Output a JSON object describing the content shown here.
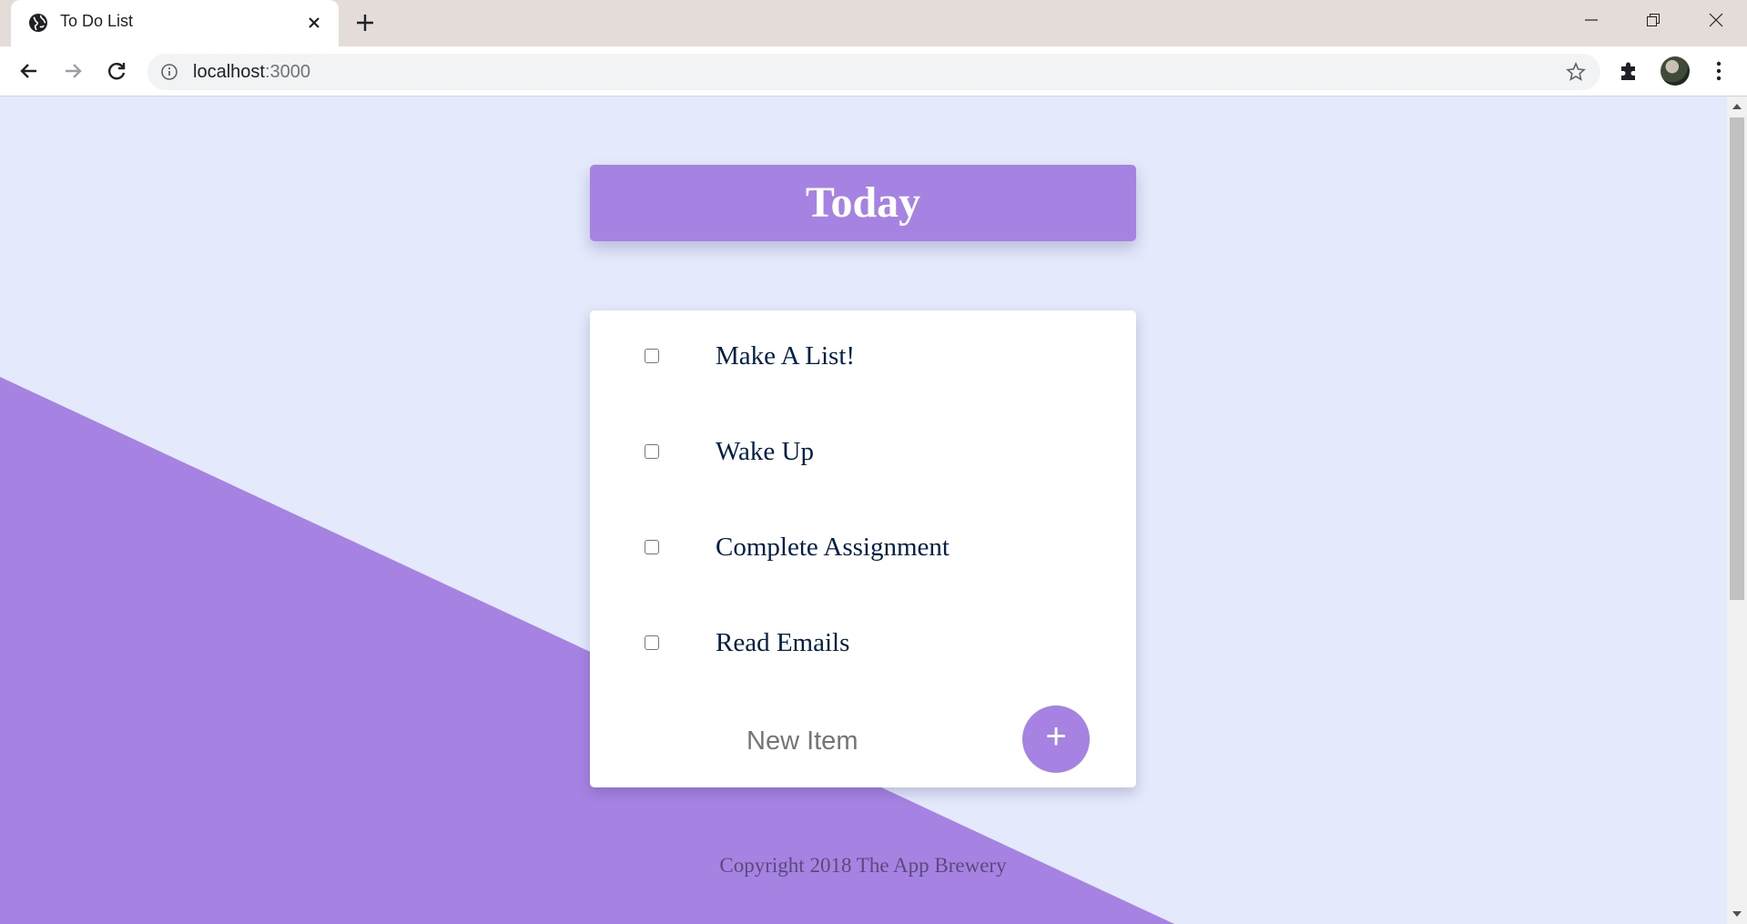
{
  "browser": {
    "tab_title": "To Do List",
    "url_host": "localhost",
    "url_port": ":3000"
  },
  "page": {
    "heading": "Today",
    "items": [
      {
        "text": "Make A List!",
        "checked": false
      },
      {
        "text": "Wake Up",
        "checked": false
      },
      {
        "text": "Complete Assignment",
        "checked": false
      },
      {
        "text": "Read Emails",
        "checked": false
      }
    ],
    "new_item_placeholder": "New Item",
    "add_button_label": "+",
    "footer": "Copyright 2018 The App Brewery"
  },
  "colors": {
    "accent": "#a683e3",
    "page_bg": "#e4e9fb",
    "item_text": "#00204a"
  }
}
